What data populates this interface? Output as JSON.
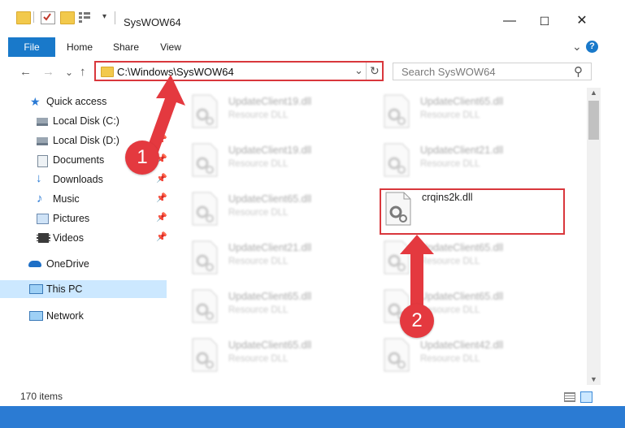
{
  "window": {
    "title": "SysWOW64",
    "minimize": "—",
    "maximize": "☐",
    "close": "✕"
  },
  "ribbon": {
    "tabs": [
      "File",
      "Home",
      "Share",
      "View"
    ],
    "expand": "⌄",
    "help": "?"
  },
  "nav": {
    "back": "←",
    "forward": "→",
    "recent": "⌄",
    "up": "↑"
  },
  "address": {
    "path": "C:\\Windows\\SysWOW64",
    "dropdown": "⌄",
    "refresh": "↻"
  },
  "search": {
    "placeholder": "Search SysWOW64",
    "icon": "⚲"
  },
  "sidebar": {
    "items": [
      {
        "label": "Quick access",
        "icon": "star-icon",
        "pinned": false
      },
      {
        "label": "Local Disk (C:)",
        "icon": "drive-icon",
        "pinned": true
      },
      {
        "label": "Local Disk (D:)",
        "icon": "drive-icon",
        "pinned": true
      },
      {
        "label": "Documents",
        "icon": "documents-icon",
        "pinned": true
      },
      {
        "label": "Downloads",
        "icon": "downloads-icon",
        "pinned": true
      },
      {
        "label": "Music",
        "icon": "music-icon",
        "pinned": true
      },
      {
        "label": "Pictures",
        "icon": "pictures-icon",
        "pinned": true
      },
      {
        "label": "Videos",
        "icon": "videos-icon",
        "pinned": true
      },
      {
        "label": "OneDrive",
        "icon": "cloud-icon",
        "pinned": false
      },
      {
        "label": "This PC",
        "icon": "computer-icon",
        "pinned": false
      },
      {
        "label": "Network",
        "icon": "network-icon",
        "pinned": false
      }
    ]
  },
  "files": {
    "col1": [
      {
        "name": "UpdateClient19.dll",
        "desc": "Resource DLL"
      },
      {
        "name": "UpdateClient19.dll",
        "desc": "Resource DLL"
      },
      {
        "name": "UpdateClient65.dll",
        "desc": "Resource DLL"
      },
      {
        "name": "UpdateClient21.dll",
        "desc": "Resource DLL"
      },
      {
        "name": "UpdateClient65.dll",
        "desc": "Resource DLL"
      },
      {
        "name": "UpdateClient65.dll",
        "desc": "Resource DLL"
      }
    ],
    "col2": [
      {
        "name": "UpdateClient65.dll",
        "desc": "Resource DLL"
      },
      {
        "name": "UpdateClient21.dll",
        "desc": "Resource DLL"
      },
      {
        "name": "crqins2k.dll",
        "desc": ""
      },
      {
        "name": "UpdateClient65.dll",
        "desc": "Resource DLL"
      },
      {
        "name": "UpdateClient65.dll",
        "desc": "Resource DLL"
      },
      {
        "name": "UpdateClient42.dll",
        "desc": "Resource DLL"
      }
    ]
  },
  "status": {
    "count": "170 items"
  },
  "callouts": {
    "one": "1",
    "two": "2"
  },
  "colors": {
    "accent": "#1979ca",
    "highlight": "#d9373c",
    "selected": "#cce8ff"
  }
}
